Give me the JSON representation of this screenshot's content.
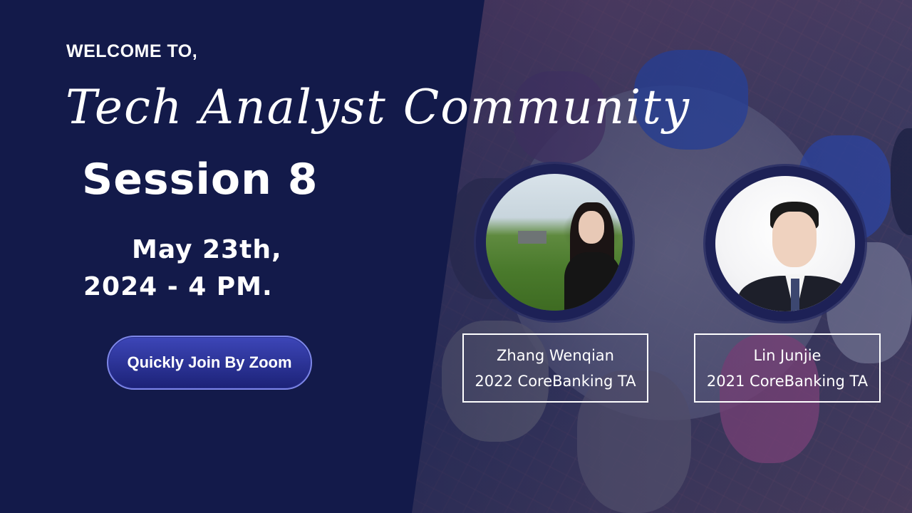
{
  "welcome": "WELCOME TO,",
  "title": "Tech Analyst Community",
  "session": "Session 8",
  "date": {
    "line1": "May 23th,",
    "line2": "2024 - 4 PM."
  },
  "join_button": "Quickly Join By Zoom",
  "speakers": [
    {
      "name": "Zhang Wenqian",
      "role": "2022 CoreBanking TA"
    },
    {
      "name": "Lin Junjie",
      "role": "2021 CoreBanking TA"
    }
  ],
  "colors": {
    "background": "#131a4a",
    "button": "#2a3190",
    "text": "#ffffff"
  }
}
